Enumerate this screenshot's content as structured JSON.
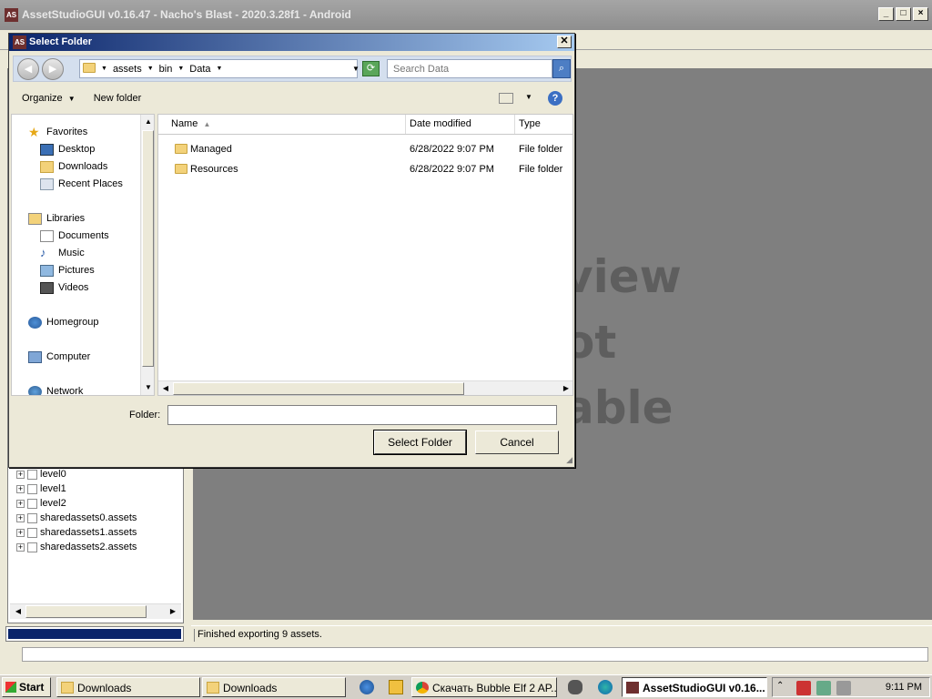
{
  "app": {
    "title": "AssetStudioGUI v0.16.47 - Nacho's Blast - 2020.3.28f1 - Android",
    "icon_text": "AS",
    "preview_lines": [
      "view",
      "ot",
      "able"
    ],
    "tree_items": [
      "level0",
      "level1",
      "level2",
      "sharedassets0.assets",
      "sharedassets1.assets",
      "sharedassets2.assets"
    ],
    "status": "Finished exporting 9 assets.",
    "progress": 1.0
  },
  "dialog": {
    "title": "Select Folder",
    "icon_text": "AS",
    "close_glyph": "✕",
    "breadcrumb": [
      "assets",
      "bin",
      "Data"
    ],
    "search_placeholder": "Search Data",
    "commands": {
      "organize": "Organize",
      "new_folder": "New folder"
    },
    "nav": {
      "favorites": "Favorites",
      "desktop": "Desktop",
      "downloads": "Downloads",
      "recent_places": "Recent Places",
      "libraries": "Libraries",
      "documents": "Documents",
      "music": "Music",
      "pictures": "Pictures",
      "videos": "Videos",
      "homegroup": "Homegroup",
      "computer": "Computer",
      "network": "Network"
    },
    "columns": {
      "name": "Name",
      "date_modified": "Date modified",
      "type": "Type"
    },
    "files": [
      {
        "name": "Managed",
        "date": "6/28/2022 9:07 PM",
        "type": "File folder"
      },
      {
        "name": "Resources",
        "date": "6/28/2022 9:07 PM",
        "type": "File folder"
      }
    ],
    "folder_label": "Folder:",
    "folder_value": "",
    "select_button": "Select Folder",
    "cancel_button": "Cancel"
  },
  "taskbar": {
    "start": "Start",
    "tasks": [
      "Downloads",
      "Downloads",
      "Скачать Bubble Elf 2 AP...",
      "AssetStudioGUI v0.16..."
    ],
    "clock": "9:11 PM"
  },
  "colors": {
    "title_gradient_start": "#0a246a",
    "progress_fill": "#0a246a",
    "preview_bg": "#7f7f7f"
  }
}
